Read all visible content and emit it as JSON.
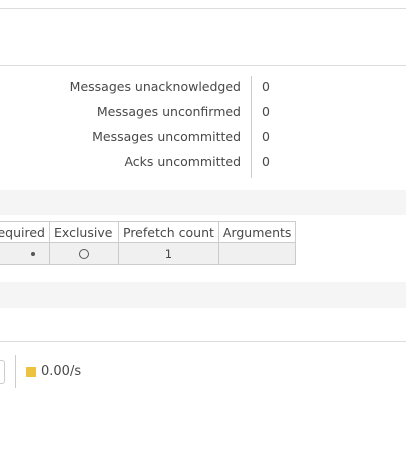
{
  "stats": {
    "partial_link": "e",
    "rows": [
      {
        "label": "Messages unacknowledged",
        "value": "0"
      },
      {
        "label": "Messages unconfirmed",
        "value": "0"
      },
      {
        "label": "Messages uncommitted",
        "value": "0"
      },
      {
        "label": "Acks uncommitted",
        "value": "0"
      }
    ]
  },
  "consumers_table": {
    "headers": {
      "required": "equired",
      "exclusive": "Exclusive",
      "prefetch": "Prefetch count",
      "arguments": "Arguments"
    },
    "rows": [
      {
        "required": "filled-dot",
        "exclusive": "empty-radio",
        "prefetch": "1",
        "arguments": ""
      }
    ]
  },
  "rate": {
    "value": "0.00/s",
    "legend_color": "#edc240"
  }
}
